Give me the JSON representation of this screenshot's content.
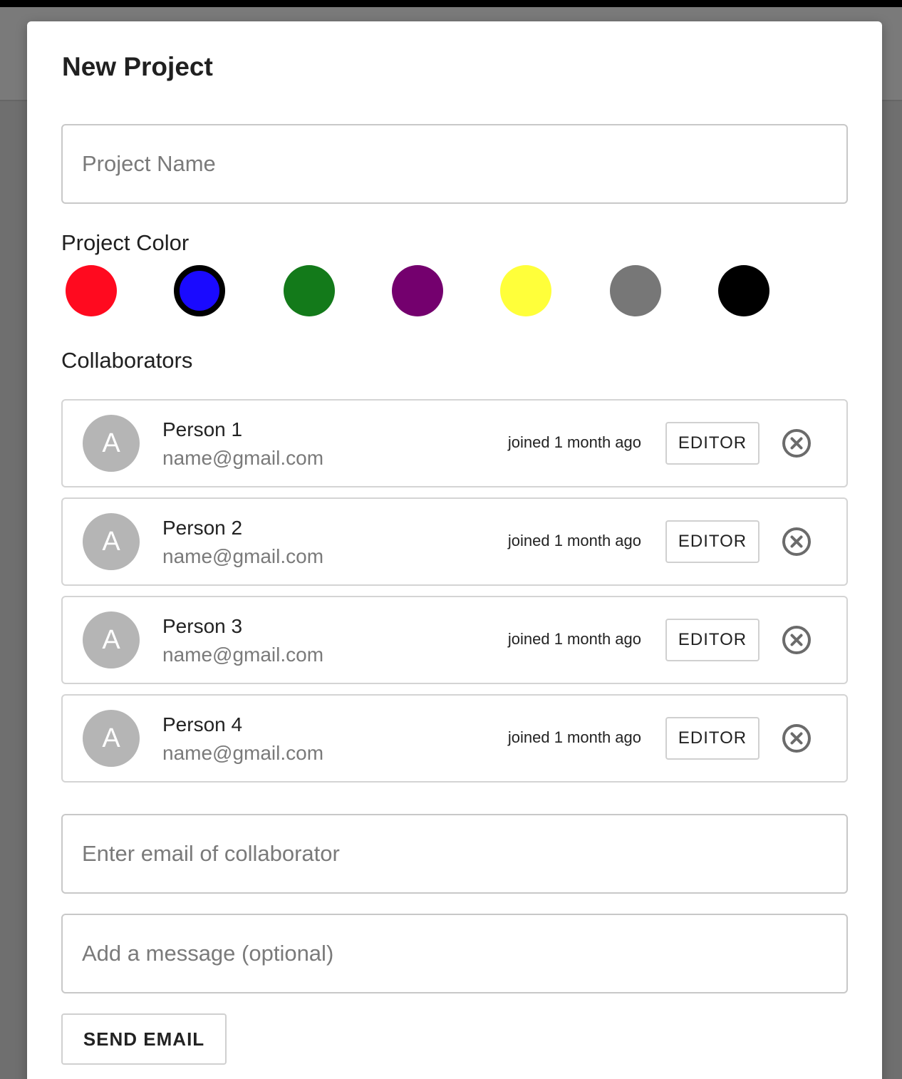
{
  "dialog": {
    "title": "New Project",
    "project_name_placeholder": "Project Name",
    "project_name_value": "",
    "color_label": "Project Color",
    "colors": [
      "#ff0a1f",
      "#1a0aff",
      "#137a1a",
      "#74006e",
      "#ffff3a",
      "#777777",
      "#000000"
    ],
    "selected_color_index": 1,
    "collaborators_label": "Collaborators",
    "collaborators": [
      {
        "initial": "A",
        "name": "Person 1",
        "email": "name@gmail.com",
        "joined": "joined 1 month ago",
        "role": "EDITOR"
      },
      {
        "initial": "A",
        "name": "Person 2",
        "email": "name@gmail.com",
        "joined": "joined 1 month ago",
        "role": "EDITOR"
      },
      {
        "initial": "A",
        "name": "Person 3",
        "email": "name@gmail.com",
        "joined": "joined 1 month ago",
        "role": "EDITOR"
      },
      {
        "initial": "A",
        "name": "Person 4",
        "email": "name@gmail.com",
        "joined": "joined 1 month ago",
        "role": "EDITOR"
      }
    ],
    "remove_icon": "close-circle-icon",
    "email_placeholder": "Enter email of collaborator",
    "email_value": "",
    "message_placeholder": "Add a message (optional)",
    "message_value": "",
    "send_label": "SEND EMAIL"
  }
}
